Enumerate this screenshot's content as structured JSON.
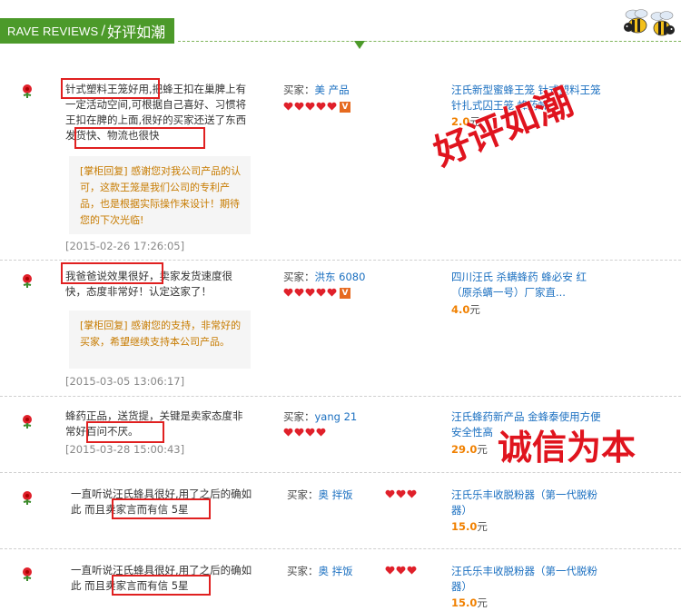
{
  "header": {
    "title_en": "RAVE REVIEWS",
    "separator": "/",
    "title_cn": "好评如潮"
  },
  "reviews": [
    {
      "comment": "针式塑料王笼好用,把蜂王扣在巢脾上有一定活动空间,可根据自己喜好、习惯将王扣在脾的上面,很好的买家还送了东西发货快、物流也很快",
      "reply": "[掌柜回复] 感谢您对我公司产品的认可，这款王笼是我们公司的专利产品，也是根据实际操作来设计！期待您的下次光临!",
      "date": "[2015-02-26 17:26:05]",
      "buyer_label": "买家：",
      "buyer_name": "美 产品",
      "product": "汪氏新型蜜蜂王笼 针式塑料王笼针扎式囚王笼 蜂药蜂...",
      "price": "2.0",
      "unit": "元"
    },
    {
      "comment": "我爸爸说效果很好，卖家发货速度很快，态度非常好！认定这家了！",
      "reply": "[掌柜回复] 感谢您的支持，非常好的买家，希望继续支持本公司产品。",
      "date": "[2015-03-05 13:06:17]",
      "buyer_label": "买家：",
      "buyer_name": "洪东 6080",
      "product": "四川汪氏 杀螨蜂药 蜂必安 红（原杀螨一号）厂家直...",
      "price": "4.0",
      "unit": "元"
    },
    {
      "comment": "蜂药正品，送货提，关键是卖家态度非常好百问不厌。",
      "date": "[2015-03-28 15:00:43]",
      "buyer_label": "买家：",
      "buyer_name": "yang 21",
      "product": "汪氏蜂药新产品 金蜂泰使用方便安全性高",
      "price": "29.0",
      "unit": "元"
    },
    {
      "comment": "一直听说汪氏蜂具很好,用了之后的确如此 而且卖家言而有信 5星",
      "buyer_label": "买家：",
      "buyer_name": "奥 拌饭",
      "product": "汪氏乐丰收脱粉器（第一代脱粉器）",
      "price": "15.0",
      "unit": "元"
    },
    {
      "comment": "一直听说汪氏蜂具很好,用了之后的确如此 而且卖家言而有信 5星",
      "buyer_label": "买家：",
      "buyer_name": "奥 拌饭",
      "product": "汪氏乐丰收脱粉器（第一代脱粉器）",
      "price": "15.0",
      "unit": "元"
    }
  ],
  "stamps": {
    "stamp1": "好评如潮",
    "stamp2": "诚信为本"
  },
  "colors": {
    "header_green": "#4c9a2a",
    "link_blue": "#1a6fc0",
    "price_orange": "#f08000",
    "stamp_red": "#e0141e",
    "reply_gold": "#c77b00"
  }
}
